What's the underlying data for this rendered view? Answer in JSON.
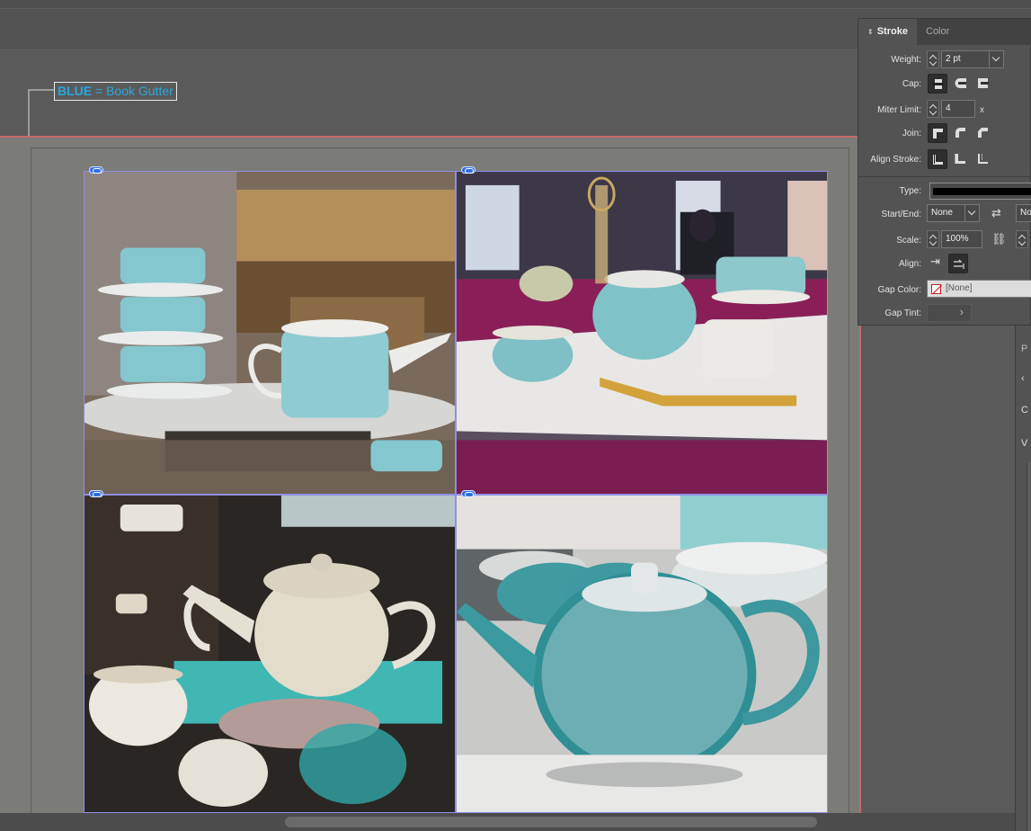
{
  "callout": {
    "keyword": "BLUE",
    "text": " = Book Gutter"
  },
  "stroke_panel": {
    "tabs": [
      {
        "label": "Stroke"
      },
      {
        "label": "Color"
      }
    ],
    "weight": {
      "label": "Weight:",
      "value": "2 pt"
    },
    "cap": {
      "label": "Cap:"
    },
    "miter_limit": {
      "label": "Miter Limit:",
      "value": "4",
      "unit": "x"
    },
    "join": {
      "label": "Join:"
    },
    "align_stroke": {
      "label": "Align Stroke:"
    },
    "type": {
      "label": "Type:"
    },
    "start_end": {
      "label": "Start/End:",
      "start": "None",
      "end": "No"
    },
    "scale": {
      "label": "Scale:",
      "value": "100%"
    },
    "align": {
      "label": "Align:"
    },
    "gap_color": {
      "label": "Gap Color:",
      "value": "[None]"
    },
    "gap_tint": {
      "label": "Gap Tint:"
    }
  },
  "side_panel": {
    "icons": [
      "P",
      "‹",
      "C",
      "V"
    ]
  },
  "colors": {
    "bleed": "#c46a6a",
    "frame_border": "#8f8fe6",
    "callout_text": "#29a8e0"
  }
}
